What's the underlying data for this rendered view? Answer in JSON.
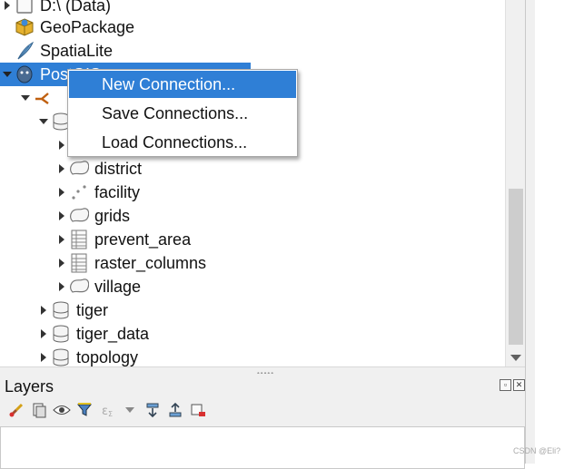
{
  "browser": {
    "items": [
      {
        "label": "D:\\ (Data)",
        "icon": "drive-icon",
        "expander": "collapsed"
      },
      {
        "label": "GeoPackage",
        "icon": "geopackage-icon",
        "expander": "none"
      },
      {
        "label": "SpatiaLite",
        "icon": "spatialite-icon",
        "expander": "none"
      },
      {
        "label": "PostGIS",
        "icon": "postgis-icon",
        "expander": "expanded",
        "selected": true
      },
      {
        "label": "",
        "icon": "connection-icon",
        "expander": "expanded"
      },
      {
        "label": "",
        "icon": "schema-icon",
        "expander": "expanded"
      },
      {
        "label": "",
        "icon": "polygon-layer-icon",
        "expander": "collapsed"
      },
      {
        "label": "district",
        "icon": "polygon-layer-icon",
        "expander": "collapsed"
      },
      {
        "label": "facility",
        "icon": "point-layer-icon",
        "expander": "collapsed"
      },
      {
        "label": "grids",
        "icon": "polygon-layer-icon",
        "expander": "collapsed"
      },
      {
        "label": "prevent_area",
        "icon": "table-icon",
        "expander": "collapsed"
      },
      {
        "label": "raster_columns",
        "icon": "table-icon",
        "expander": "collapsed"
      },
      {
        "label": "village",
        "icon": "polygon-layer-icon",
        "expander": "collapsed"
      },
      {
        "label": "tiger",
        "icon": "schema-icon",
        "expander": "collapsed"
      },
      {
        "label": "tiger_data",
        "icon": "schema-icon",
        "expander": "collapsed"
      },
      {
        "label": "topology",
        "icon": "schema-icon",
        "expander": "collapsed"
      }
    ]
  },
  "context_menu": {
    "items": [
      {
        "label": "New Connection...",
        "highlighted": true
      },
      {
        "label": "Save Connections..."
      },
      {
        "label": "Load Connections..."
      }
    ]
  },
  "layers_panel": {
    "title": "Layers",
    "toolbar_icons": [
      "style-brush-icon",
      "add-group-icon",
      "eye-icon",
      "filter-icon",
      "filter-expression-icon",
      "chevron-down-icon",
      "expand-all-icon",
      "collapse-all-icon",
      "remove-layer-icon"
    ],
    "panel_buttons": [
      "float-icon",
      "close-icon"
    ]
  },
  "watermark": "CSDN @Eli?",
  "colors": {
    "selection": "#2f7fd6",
    "panel_bg": "#f0f0f0"
  }
}
